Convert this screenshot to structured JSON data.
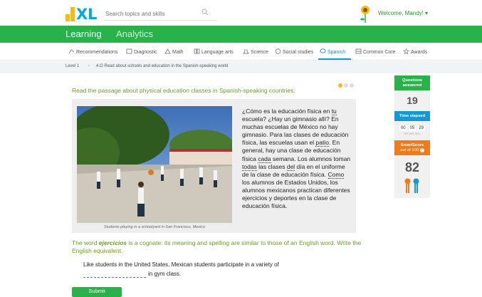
{
  "header": {
    "search_placeholder": "Search topics and skills",
    "welcome": "Welcome, Mandy! ▾"
  },
  "tabs": {
    "learning": "Learning",
    "analytics": "Analytics"
  },
  "subjects": [
    "Recommendations",
    "Diagnostic",
    "Math",
    "Language arts",
    "Science",
    "Social studies",
    "Spanish",
    "Common Core",
    "Awards"
  ],
  "breadcrumb": {
    "level": "Level 1",
    "sep": ">",
    "skill": "4.O Read about schools and education in the Spanish-speaking world"
  },
  "question": {
    "prompt": "Read the passage about physical education classes in Spanish-speaking countries.",
    "caption": "Students playing in a schoolyard in San Francisco, Mexico",
    "cognate_prefix": "The word ",
    "cognate_word": "ejercicios",
    "cognate_suffix": " is a cognate: its meaning and spelling are similar to those of an English word. Write the English equivalent.",
    "sentence_before": "Like students in the United States, Mexican students participate in a variety of",
    "sentence_after": "in gym class.",
    "submit": "Submit"
  },
  "passage_parts": [
    "¿Cómo es la educación física en ",
    "tu",
    " escuela? ¿Hay un gimnasio allí? En muchas escuelas de México no hay gimnasio. Para las clases de educación física, las escuelas usan el ",
    "patio",
    ". En general, hay una clase de educación física ",
    "cada",
    " semana. Los alumnos toman ",
    "todas",
    " las clases ",
    "del",
    " día en el uniforme de la clase de educación física. ",
    "Como",
    " los alumnos de Estados Unidos, los alumnos mexicanos practican diferentes ejercicios y deportes en la clase de educación física."
  ],
  "sidebar": {
    "questions_label": "Questions answered",
    "questions_value": "19",
    "time_label": "Time elapsed",
    "time_hr": "00",
    "time_min": "05",
    "time_sec": "29",
    "time_units": "HR   MIN   SEC",
    "smartscore_label": "SmartScore",
    "smartscore_sub": "out of 100",
    "smartscore_value": "82"
  },
  "colors": {
    "brand_green": "#2ab24a",
    "prompt_green": "#6a9f1b",
    "link_blue": "#1697d6",
    "smartscore_orange": "#f07b1d"
  }
}
